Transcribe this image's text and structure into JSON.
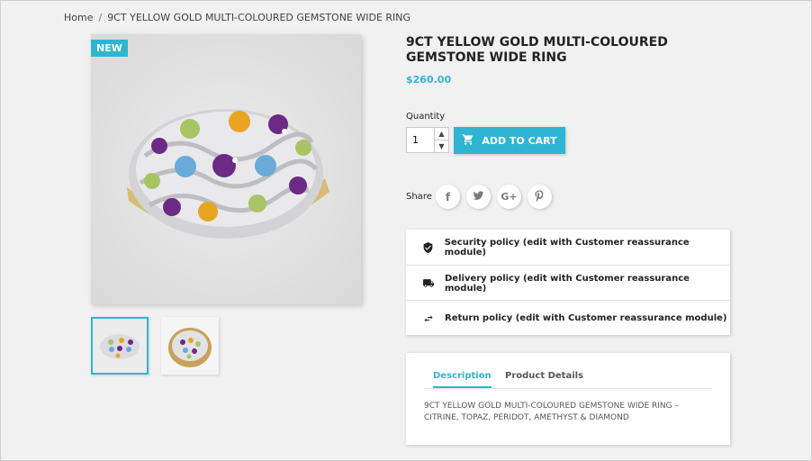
{
  "breadcrumb": {
    "home": "Home",
    "separator": "/",
    "current": "9CT YELLOW GOLD MULTI-COLOURED GEMSTONE WIDE RING"
  },
  "badge": {
    "new": "NEW"
  },
  "product": {
    "title": "9CT YELLOW GOLD MULTI-COLOURED GEMSTONE WIDE RING",
    "price": "$260.00",
    "quantity_label": "Quantity",
    "quantity_value": "1",
    "add_to_cart": "ADD TO CART"
  },
  "share": {
    "label": "Share",
    "buttons": [
      "facebook-icon",
      "twitter-icon",
      "google-plus-icon",
      "pinterest-icon"
    ]
  },
  "reassurance": [
    {
      "icon": "shield-check-icon",
      "text": "Security policy (edit with Customer reassurance module)"
    },
    {
      "icon": "truck-icon",
      "text": "Delivery policy (edit with Customer reassurance module)"
    },
    {
      "icon": "swap-arrows-icon",
      "text": "Return policy (edit with Customer reassurance module)"
    }
  ],
  "tabs": {
    "description": "Description",
    "product_details": "Product Details"
  },
  "description_text": "9CT YELLOW GOLD MULTI-COLOURED GEMSTONE WIDE RING – CITRINE, TOPAZ, PERIDOT, AMETHYST & DIAMOND",
  "colors": {
    "accent": "#2fb5d2",
    "background": "#f1f1f1"
  }
}
